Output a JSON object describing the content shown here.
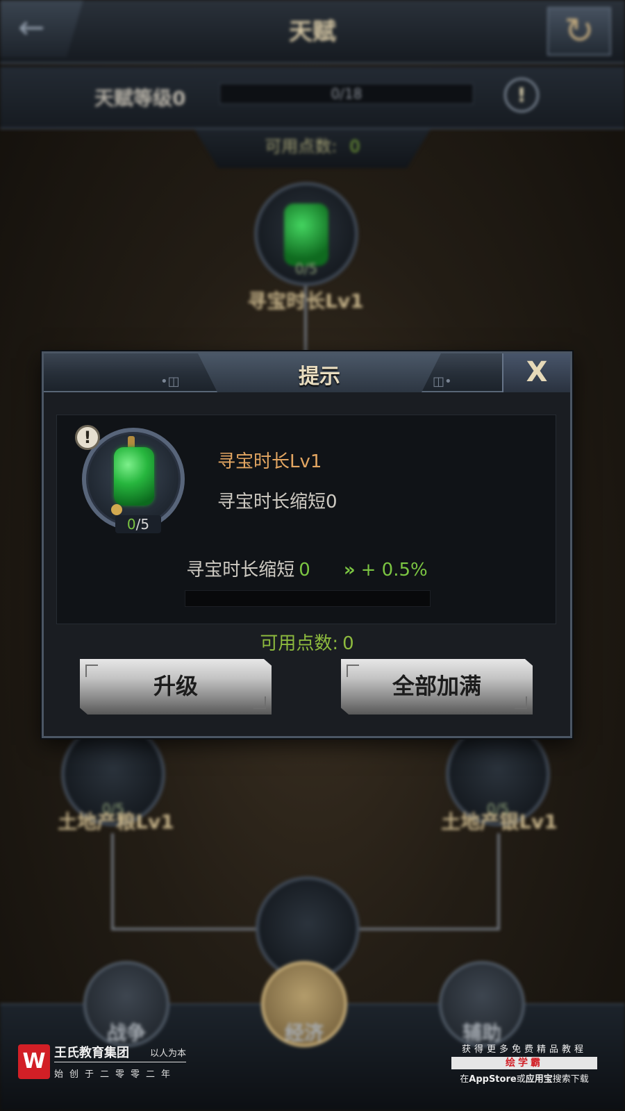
{
  "screen": {
    "title": "天赋",
    "back_icon": "←",
    "refresh_icon": "↻",
    "talent_level_label": "天赋等级0",
    "talent_level_progress": "0/18",
    "talent_level_fraction": 0,
    "info_icon": "!",
    "available_points_label": "可用点数:",
    "available_points_value": "0",
    "tree": {
      "top_node": {
        "label": "寻宝时长Lv1",
        "count": "0/5"
      },
      "left_node": {
        "label": "土地产粮Lv1",
        "count": "0/5"
      },
      "right_node": {
        "label": "土地产银Lv1",
        "count": "0/5"
      }
    },
    "bottom_tabs": [
      {
        "label": "战争",
        "active": false
      },
      {
        "label": "经济",
        "active": true
      },
      {
        "label": "辅助",
        "active": false
      }
    ]
  },
  "dialog": {
    "title": "提示",
    "close_label": "X",
    "warn_icon": "!",
    "talent_count_current": "0",
    "talent_count_total": "/5",
    "talent_name": "寻宝时长Lv1",
    "talent_desc": "寻宝时长缩短0",
    "effect_label": "寻宝时长缩短",
    "effect_current": "0",
    "effect_arrows": "»",
    "effect_increase": "+ 0.5%",
    "progress_fraction": 0,
    "available_points_label": "可用点数:",
    "available_points_value": "0",
    "upgrade_button": "升级",
    "max_all_button": "全部加满"
  },
  "watermark": {
    "logo": "W",
    "group_name": "王氏教育集团",
    "motto": "以人为本",
    "founded": "始创于二零零二年",
    "promo_line1": "获得更多免费精品教程",
    "promo_brand": "绘学霸",
    "promo_line3_a": "在",
    "promo_line3_b": "AppStore",
    "promo_line3_c": "或",
    "promo_line3_d": "应用宝",
    "promo_line3_e": "搜索下载"
  },
  "colors": {
    "accent_green": "#7bc542",
    "talent_name_orange": "#e3a662",
    "dialog_border": "#4b5664",
    "watermark_red": "#d21f26"
  }
}
